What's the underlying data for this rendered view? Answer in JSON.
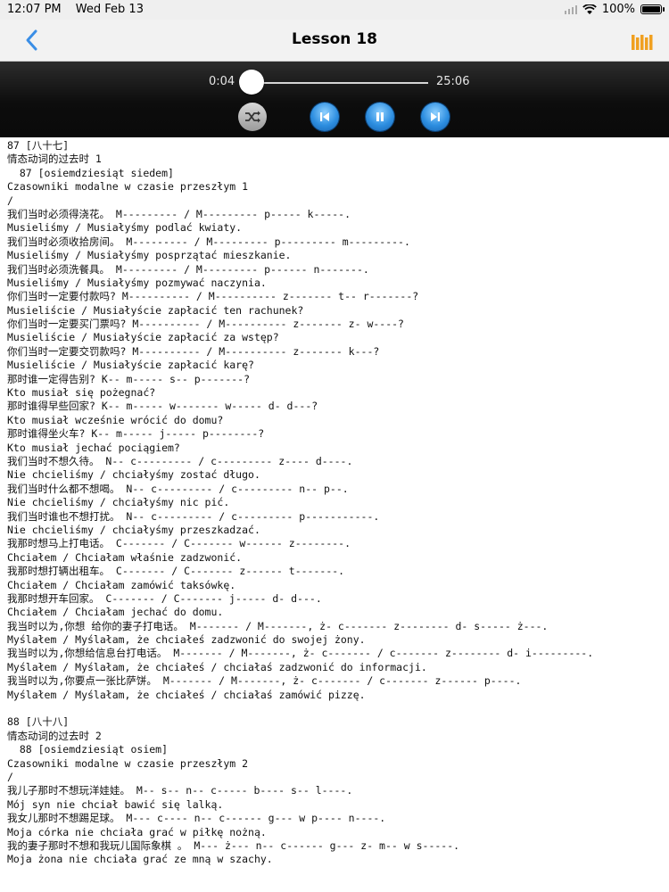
{
  "status_bar": {
    "time": "12:07 PM",
    "date": "Wed Feb 13",
    "battery": "100%",
    "battery_level": 1.0
  },
  "nav": {
    "title": "Lesson 18",
    "back_icon": "chevron-left-icon",
    "library_icon": "bars-icon",
    "accent_color": "#3a8ee6",
    "library_color": "#f0a020"
  },
  "player": {
    "elapsed": "0:04",
    "duration": "25:06",
    "progress": 0.003,
    "controls": [
      "shuffle-icon",
      "previous-icon",
      "pause-icon",
      "next-icon"
    ]
  },
  "lines": [
    "87 [八十七]",
    "情态动词的过去时 1",
    "  87 [osiemdziesiąt siedem]",
    "Czasowniki modalne w czasie przeszłym 1",
    "/",
    "我们当时必须得浇花。 M--------- / M--------- p----- k-----.",
    "Musieliśmy / Musiałyśmy podlać kwiaty.",
    "我们当时必须收拾房间。 M--------- / M--------- p--------- m---------.",
    "Musieliśmy / Musiałyśmy posprzątać mieszkanie.",
    "我们当时必须洗餐具。 M--------- / M--------- p------ n-------.",
    "Musieliśmy / Musiałyśmy pozmywać naczynia.",
    "你们当时一定要付款吗? M---------- / M---------- z------- t-- r-------?",
    "Musieliście / Musiałyście zapłacić ten rachunek?",
    "你们当时一定要买门票吗? M---------- / M---------- z------- z- w----?",
    "Musieliście / Musiałyście zapłacić za wstęp?",
    "你们当时一定要交罚款吗? M---------- / M---------- z------- k---?",
    "Musieliście / Musiałyście zapłacić karę?",
    "那时谁一定得告别? K-- m----- s-- p-------?",
    "Kto musiał się pożegnać?",
    "那时谁得早些回家? K-- m----- w------- w----- d- d---?",
    "Kto musiał wcześnie wrócić do domu?",
    "那时谁得坐火车? K-- m----- j----- p--------?",
    "Kto musiał jechać pociągiem?",
    "我们当时不想久待。 N-- c--------- / c--------- z---- d----.",
    "Nie chcieliśmy / chciałyśmy zostać długo.",
    "我们当时什么都不想喝。 N-- c--------- / c--------- n-- p--.",
    "Nie chcieliśmy / chciałyśmy nic pić.",
    "我们当时谁也不想打扰。 N-- c--------- / c--------- p-----------.",
    "Nie chcieliśmy / chciałyśmy przeszkadzać.",
    "我那时想马上打电话。 C------- / C------- w------ z--------.",
    "Chciałem / Chciałam właśnie zadzwonić.",
    "我那时想打辆出租车。 C------- / C------- z------ t-------.",
    "Chciałem / Chciałam zamówić taksówkę.",
    "我那时想开车回家。 C------- / C------- j----- d- d---.",
    "Chciałem / Chciałam jechać do domu.",
    "我当时以为,你想 给你的妻子打电话。 M------- / M-------, ż- c------- z-------- d- s----- ż---.",
    "Myślałem / Myślałam, że chciałeś zadzwonić do swojej żony.",
    "我当时以为,你想给信息台打电话。 M------- / M-------, ż- c------- / c------- z-------- d- i---------.",
    "Myślałem / Myślałam, że chciałeś / chciałaś zadzwonić do informacji.",
    "我当时以为,你要点一张比萨饼。 M------- / M-------, ż- c------- / c------- z------ p----.",
    "Myślałem / Myślałam, że chciałeś / chciałaś zamówić pizzę.",
    "",
    "88 [八十八]",
    "情态动词的过去时 2",
    "  88 [osiemdziesiąt osiem]",
    "Czasowniki modalne w czasie przeszłym 2",
    "/",
    "我儿子那时不想玩洋娃娃。 M-- s-- n-- c----- b---- s-- l----.",
    "Mój syn nie chciał bawić się lalką.",
    "我女儿那时不想踢足球。 M--- c---- n-- c------ g--- w p---- n----.",
    "Moja córka nie chciała grać w piłkę nożną.",
    "我的妻子那时不想和我玩儿国际象棋 。 M--- ż--- n-- c------ g--- z- m-- w s-----.",
    "Moja żona nie chciała grać ze mną w szachy."
  ]
}
